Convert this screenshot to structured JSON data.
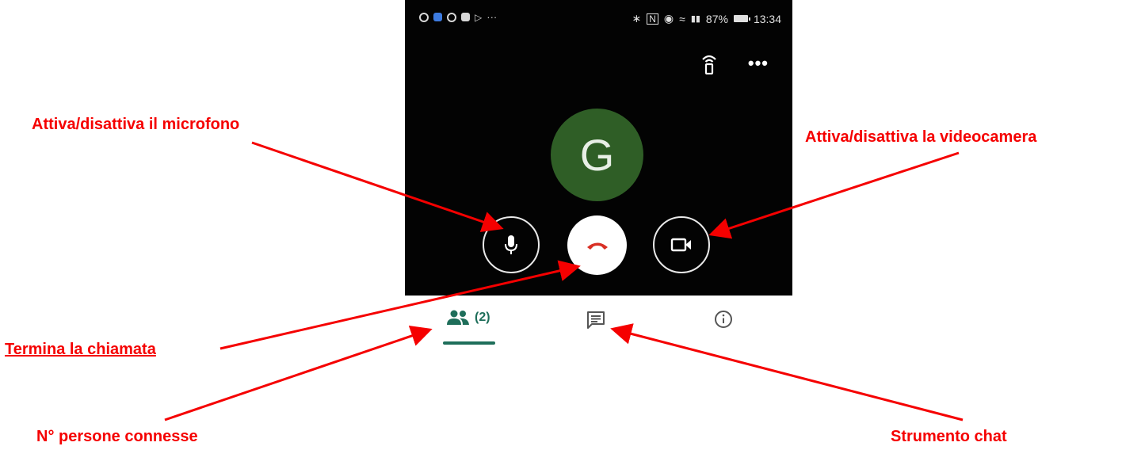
{
  "statusbar": {
    "battery_text": "87%",
    "time": "13:34",
    "left_more": "···"
  },
  "call": {
    "avatar_letter": "G",
    "avatar_color": "#2f5e26",
    "end_call_color": "#d93025",
    "icons": [
      "cast-icon",
      "more-icon",
      "microphone-icon",
      "end-call-icon",
      "videocam-icon"
    ]
  },
  "tabs": {
    "people_count": "(2)",
    "accent": "#1e6e5a",
    "icons": [
      "people-icon",
      "chat-icon",
      "info-icon"
    ]
  },
  "annotations": {
    "microphone": "Attiva/disattiva il microfono",
    "camera": "Attiva/disattiva la videocamera",
    "end_call": "Termina la chiamata",
    "people": "N° persone connesse",
    "chat": "Strumento chat",
    "color": "#f50000"
  }
}
